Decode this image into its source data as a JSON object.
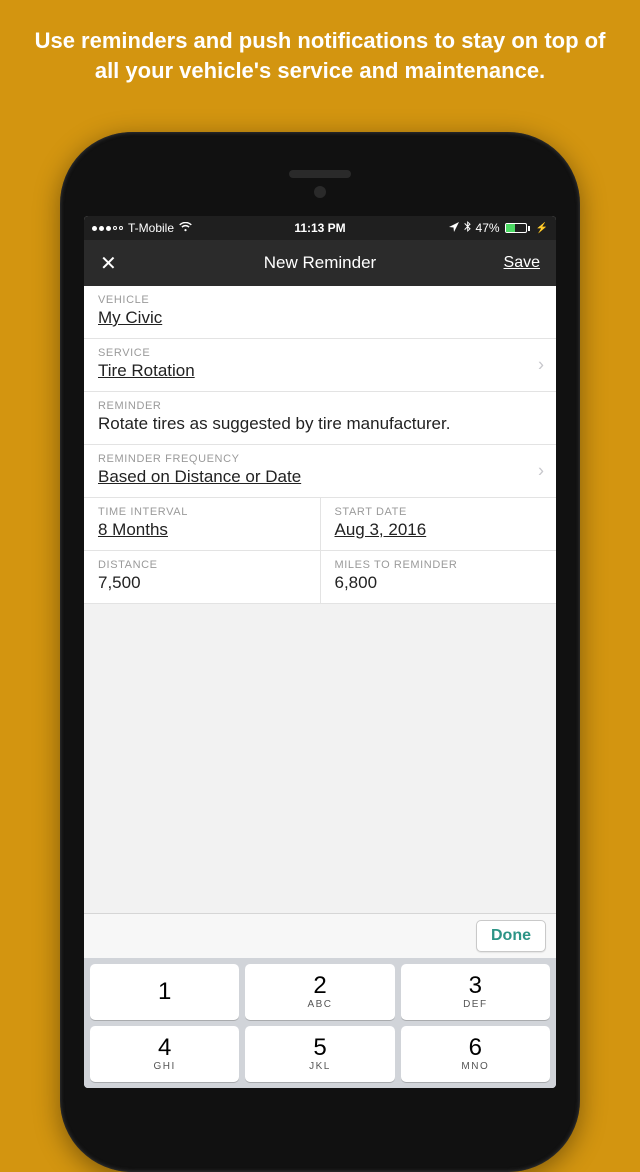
{
  "promo": "Use reminders and push notifications to stay on top of all your vehicle's service and maintenance.",
  "status": {
    "carrier": "T-Mobile",
    "time": "11:13 PM",
    "battery_pct": "47%"
  },
  "nav": {
    "title": "New Reminder",
    "save": "Save"
  },
  "form": {
    "vehicle": {
      "label": "VEHICLE",
      "value": "My Civic"
    },
    "service": {
      "label": "SERVICE",
      "value": "Tire Rotation"
    },
    "reminder": {
      "label": "REMINDER",
      "value": "Rotate tires as suggested by tire manufacturer."
    },
    "frequency": {
      "label": "REMINDER FREQUENCY",
      "value": "Based on Distance or Date"
    },
    "time_interval": {
      "label": "TIME INTERVAL",
      "value": "8 Months"
    },
    "start_date": {
      "label": "START DATE",
      "value": "Aug 3, 2016"
    },
    "distance": {
      "label": "DISTANCE",
      "value": "7,500"
    },
    "miles_to_reminder": {
      "label": "MILES TO REMINDER",
      "value": "6,800"
    }
  },
  "keyboard": {
    "done": "Done",
    "keys": [
      {
        "digit": "1",
        "letters": ""
      },
      {
        "digit": "2",
        "letters": "ABC"
      },
      {
        "digit": "3",
        "letters": "DEF"
      },
      {
        "digit": "4",
        "letters": "GHI"
      },
      {
        "digit": "5",
        "letters": "JKL"
      },
      {
        "digit": "6",
        "letters": "MNO"
      }
    ]
  }
}
